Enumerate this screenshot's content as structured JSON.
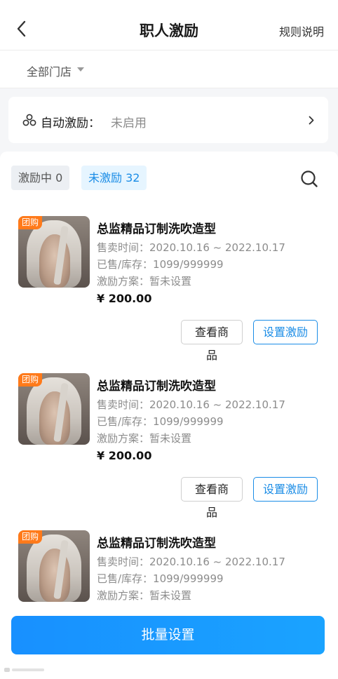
{
  "header": {
    "title": "职人激励",
    "rules_label": "规则说明"
  },
  "filter": {
    "store_label": "全部门店"
  },
  "auto_incentive": {
    "label": "自动激励：",
    "value": "未启用"
  },
  "tabs": [
    {
      "label": "激励中 0",
      "active": false
    },
    {
      "label": "未激励 32",
      "active": true
    }
  ],
  "products": [
    {
      "tag": "团购",
      "name": "总监精品订制洗吹造型",
      "sale_time": "售卖时间：2020.10.16 ~ 2022.10.17",
      "stock": "已售/库存：1099/999999",
      "plan": "激励方案：暂未设置",
      "price": "¥ 200.00",
      "view_label": "查看商品",
      "set_label": "设置激励"
    },
    {
      "tag": "团购",
      "name": "总监精品订制洗吹造型",
      "sale_time": "售卖时间：2020.10.16 ~ 2022.10.17",
      "stock": "已售/库存：1099/999999",
      "plan": "激励方案：暂未设置",
      "price": "¥ 200.00",
      "view_label": "查看商品",
      "set_label": "设置激励"
    },
    {
      "tag": "团购",
      "name": "总监精品订制洗吹造型",
      "sale_time": "售卖时间：2020.10.16 ~ 2022.10.17",
      "stock": "已售/库存：1099/999999",
      "plan": "激励方案：暂未设置"
    }
  ],
  "bottom": {
    "batch_label": "批量设置"
  },
  "colors": {
    "accent": "#1a8ce6",
    "tag": "#ff7a1a",
    "button_gradient_start": "#1890ff",
    "button_gradient_end": "#1aa3ff"
  },
  "icons": {
    "back": "chevron-left-icon",
    "search": "search-icon",
    "auto": "incentive-icon",
    "chevron": "chevron-right-icon"
  }
}
